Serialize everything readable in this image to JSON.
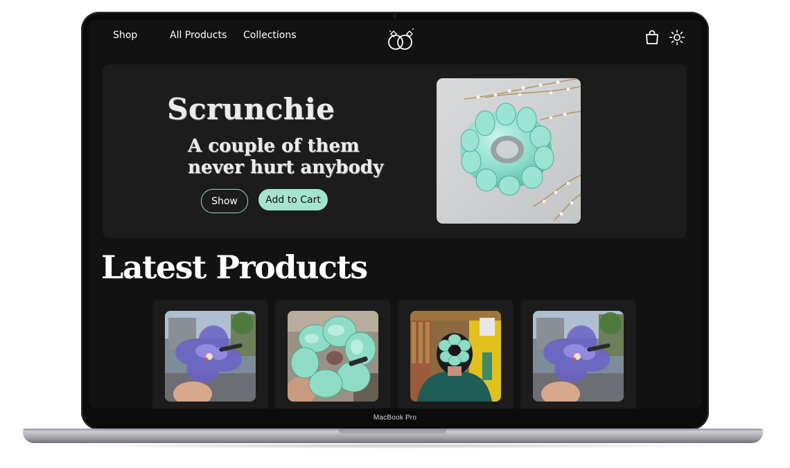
{
  "nav": {
    "links": [
      "Shop",
      "All Products",
      "Collections"
    ]
  },
  "hero": {
    "title": "Scrunchie",
    "subtitle_lines": [
      "A couple of them",
      "never hurt anybody"
    ],
    "show_label": "Show",
    "cart_label": "Add to Cart"
  },
  "latest": {
    "title": "Latest Products",
    "products": [
      {
        "image": "purple-organza-flower-clip"
      },
      {
        "image": "mint-satin-scrunchie-in-hand"
      },
      {
        "image": "mint-scrunchie-worn-in-hair-bun"
      },
      {
        "image": "purple-organza-flower-clip"
      }
    ]
  },
  "device": {
    "label": "MacBook Pro"
  },
  "colors": {
    "accent": "#a4e3cf",
    "page_bg": "#121212",
    "card_bg": "#1c1c1c",
    "text": "#ffffff"
  },
  "icons": [
    "rings-logo-icon",
    "shopping-bag-icon",
    "sun-icon"
  ]
}
